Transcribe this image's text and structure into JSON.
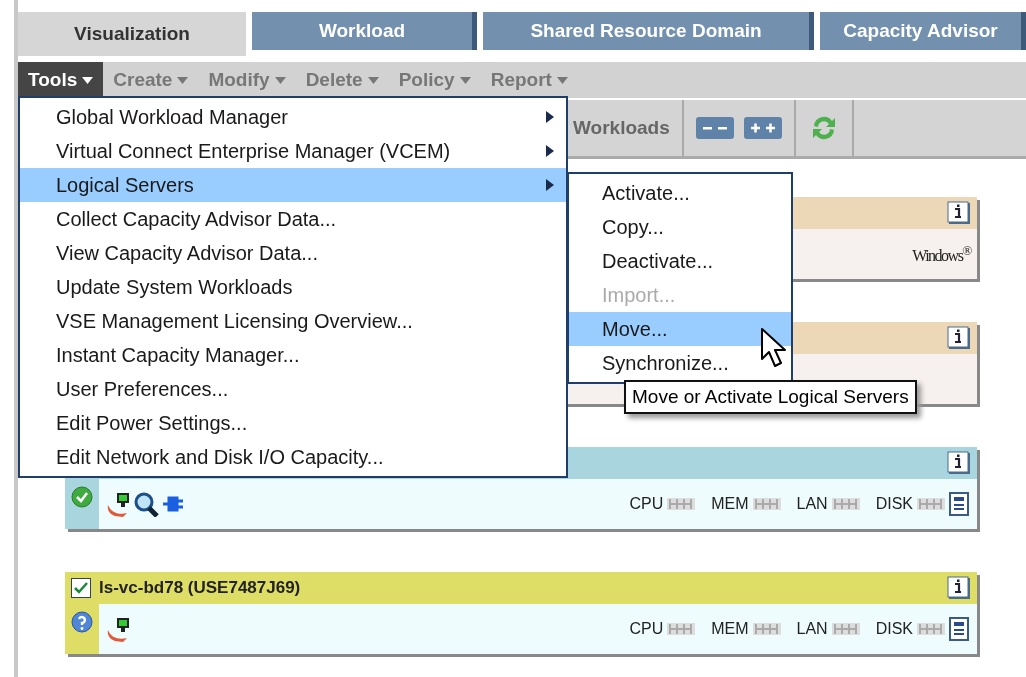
{
  "tabs": [
    {
      "label": "Visualization",
      "selected": true
    },
    {
      "label": "Workload",
      "selected": false
    },
    {
      "label": "Shared Resource Domain",
      "selected": false
    },
    {
      "label": "Capacity Advisor",
      "selected": false
    }
  ],
  "menubar": [
    {
      "label": "Tools",
      "open": true
    },
    {
      "label": "Create",
      "open": false
    },
    {
      "label": "Modify",
      "open": false
    },
    {
      "label": "Delete",
      "open": false
    },
    {
      "label": "Policy",
      "open": false
    },
    {
      "label": "Report",
      "open": false
    }
  ],
  "toolbar": {
    "label": "Workloads"
  },
  "tools_menu": [
    {
      "label": "Global Workload Manager",
      "submenu": true,
      "selected": false
    },
    {
      "label": "Virtual Connect Enterprise Manager (VCEM)",
      "submenu": true,
      "selected": false
    },
    {
      "label": "Logical Servers",
      "submenu": true,
      "selected": true
    },
    {
      "label": "Collect Capacity Advisor Data...",
      "submenu": false,
      "selected": false
    },
    {
      "label": "View Capacity Advisor Data...",
      "submenu": false,
      "selected": false
    },
    {
      "label": "Update System Workloads",
      "submenu": false,
      "selected": false
    },
    {
      "label": "VSE Management Licensing Overview...",
      "submenu": false,
      "selected": false
    },
    {
      "label": "Instant Capacity Manager...",
      "submenu": false,
      "selected": false
    },
    {
      "label": "User Preferences...",
      "submenu": false,
      "selected": false
    },
    {
      "label": "Edit Power Settings...",
      "submenu": false,
      "selected": false
    },
    {
      "label": "Edit Network and Disk I/O Capacity...",
      "submenu": false,
      "selected": false
    }
  ],
  "submenu": [
    {
      "label": "Activate...",
      "disabled": false,
      "selected": false
    },
    {
      "label": "Copy...",
      "disabled": false,
      "selected": false
    },
    {
      "label": "Deactivate...",
      "disabled": false,
      "selected": false
    },
    {
      "label": "Import...",
      "disabled": true,
      "selected": false
    },
    {
      "label": "Move...",
      "disabled": false,
      "selected": true
    },
    {
      "label": "Synchronize...",
      "disabled": false,
      "selected": false
    }
  ],
  "tooltip": "Move or Activate Logical Servers",
  "cards": [
    {
      "color": "#ecd8b6",
      "os": "Windows$^{®}$"
    },
    {
      "color": "#ecd8b6"
    },
    {
      "color": "#a9d6de",
      "status": {
        "kind": "ok"
      },
      "icons": [
        {
          "kind": "server"
        },
        {
          "kind": "search"
        },
        {
          "kind": "plug"
        }
      ],
      "metrics": [
        "CPU",
        "MEM",
        "LAN",
        "DISK"
      ]
    },
    {
      "color": "#dede66",
      "checked": true,
      "title": "ls-vc-bd78 (USE7487J69)",
      "status": {
        "kind": "unknown"
      },
      "icons": [
        {
          "kind": "server"
        }
      ],
      "metrics": [
        "CPU",
        "MEM",
        "LAN",
        "DISK"
      ]
    }
  ]
}
